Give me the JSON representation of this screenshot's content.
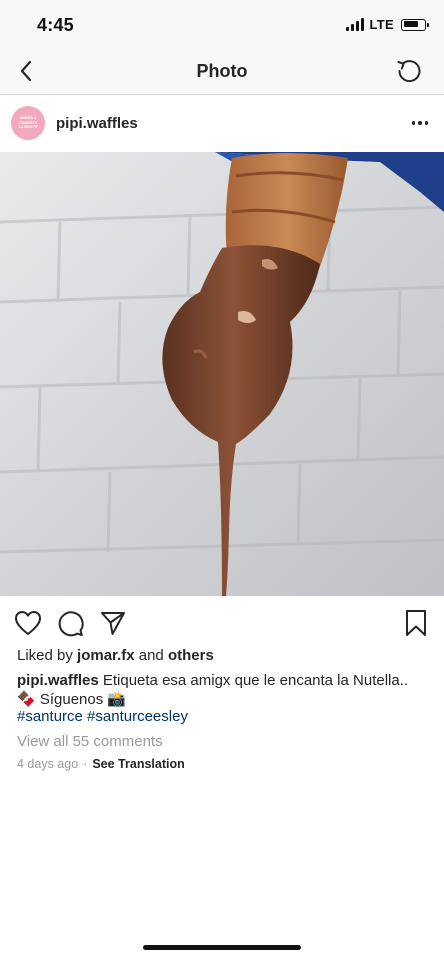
{
  "status_bar": {
    "time": "4:45",
    "network": "LTE",
    "battery_level": 0.75
  },
  "nav": {
    "title": "Photo",
    "back_icon": "chevron-left-icon",
    "refresh_icon": "refresh-icon"
  },
  "post": {
    "avatar_text": [
      "VAMOS A",
      "COMERTE",
      "LA MENTE"
    ],
    "username": "pipi.waffles",
    "more_icon": "more-horizontal-icon",
    "image_alt": "Waffle on a stick dipped in dripping chocolate in front of a white brick wall"
  },
  "actions": {
    "like_icon": "heart-icon",
    "comment_icon": "comment-icon",
    "share_icon": "send-icon",
    "save_icon": "bookmark-icon"
  },
  "likes": {
    "prefix": "Liked by",
    "user": "jomar.fx",
    "and": "and",
    "others": "others"
  },
  "caption": {
    "username": "pipi.waffles",
    "text": "Etiqueta esa amigx que le encanta la Nutella..",
    "line2": "🍫 Síguenos 📸",
    "hashtag_1": "#santurce",
    "hashtag_2": "#santurceesley"
  },
  "comments": {
    "view_all": "View all 55 comments"
  },
  "meta": {
    "time_ago": "4 days ago",
    "separator": "·",
    "see_translation": "See Translation"
  },
  "colors": {
    "link": "#003569",
    "muted": "#999999",
    "text": "#262626",
    "avatar_bg": "#f3a9bd"
  }
}
